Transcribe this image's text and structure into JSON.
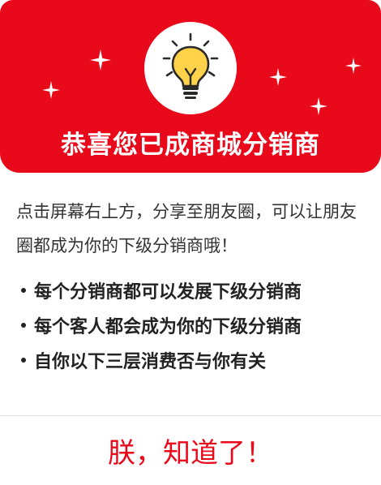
{
  "header": {
    "title": "恭喜您已成商城分销商",
    "icon": "lightbulb-icon",
    "sparkle_icon": "sparkle-icon",
    "color": "#e8091b"
  },
  "intro": {
    "text": "点击屏幕右上方，分享至朋友圈，可以让朋友圈都成为你的下级分销商哦！"
  },
  "benefits": [
    "每个分销商都可以发展下级分销商",
    "每个客人都会成为你的下级分销商",
    "自你以下三层消费否与你有关"
  ],
  "confirm": {
    "label": "朕，知道了！",
    "color": "#e8091b"
  }
}
